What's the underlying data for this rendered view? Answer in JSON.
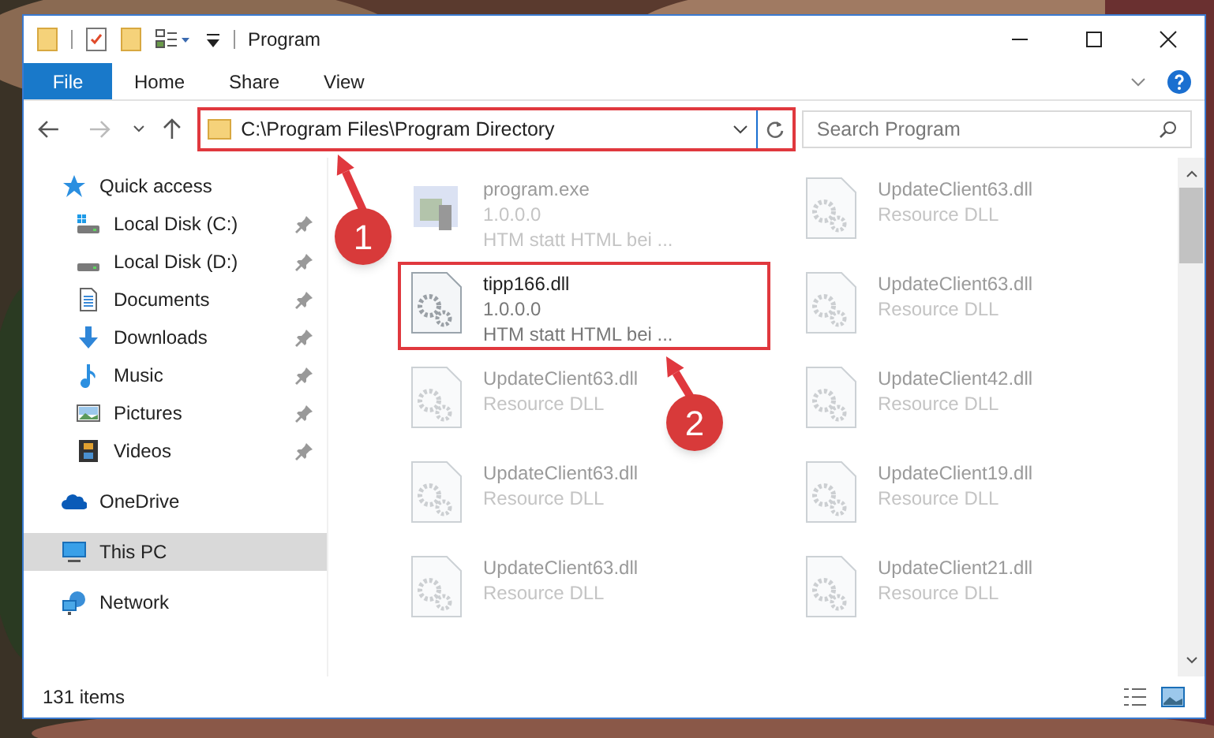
{
  "window": {
    "title": "Program"
  },
  "ribbon_tabs": [
    {
      "label": "File",
      "kind": "file"
    },
    {
      "label": "Home",
      "kind": "tab"
    },
    {
      "label": "Share",
      "kind": "tab"
    },
    {
      "label": "View",
      "kind": "tab"
    }
  ],
  "address_bar": {
    "path": "C:\\Program Files\\Program Directory",
    "highlighted": true
  },
  "search": {
    "placeholder": "Search Program"
  },
  "navigation": [
    {
      "label": "Quick access",
      "kind": "quickaccess",
      "selected": false,
      "children": [
        {
          "label": "Local Disk (C:)",
          "kind": "systemdrive",
          "pinned": true
        },
        {
          "label": "Local Disk (D:)",
          "kind": "drive",
          "pinned": true
        },
        {
          "label": "Documents",
          "kind": "documents",
          "pinned": true
        },
        {
          "label": "Downloads",
          "kind": "downloads",
          "pinned": true
        },
        {
          "label": "Music",
          "kind": "music",
          "pinned": true
        },
        {
          "label": "Pictures",
          "kind": "pictures",
          "pinned": true
        },
        {
          "label": "Videos",
          "kind": "videos",
          "pinned": true
        }
      ]
    },
    {
      "label": "OneDrive",
      "kind": "cloud",
      "selected": false
    },
    {
      "label": "This PC",
      "kind": "computer",
      "selected": true
    },
    {
      "label": "Network",
      "kind": "network",
      "selected": false
    }
  ],
  "files": [
    {
      "name": "program.exe",
      "lines": [
        "1.0.0.0",
        "HTM statt HTML bei ..."
      ],
      "kind": "exe",
      "blurred": true,
      "highlighted": false
    },
    {
      "name": "UpdateClient63.dll",
      "lines": [
        "Resource DLL"
      ],
      "kind": "dll",
      "blurred": true,
      "highlighted": false
    },
    {
      "name": "tipp166.dll",
      "lines": [
        "1.0.0.0",
        "HTM statt HTML bei ..."
      ],
      "kind": "dll",
      "blurred": false,
      "highlighted": true
    },
    {
      "name": "UpdateClient63.dll",
      "lines": [
        "Resource DLL"
      ],
      "kind": "dll",
      "blurred": true,
      "highlighted": false
    },
    {
      "name": "UpdateClient63.dll",
      "lines": [
        "Resource DLL"
      ],
      "kind": "dll",
      "blurred": true,
      "highlighted": false
    },
    {
      "name": "UpdateClient42.dll",
      "lines": [
        "Resource DLL"
      ],
      "kind": "dll",
      "blurred": true,
      "highlighted": false
    },
    {
      "name": "UpdateClient63.dll",
      "lines": [
        "Resource DLL"
      ],
      "kind": "dll",
      "blurred": true,
      "highlighted": false
    },
    {
      "name": "UpdateClient19.dll",
      "lines": [
        "Resource DLL"
      ],
      "kind": "dll",
      "blurred": true,
      "highlighted": false
    },
    {
      "name": "UpdateClient63.dll",
      "lines": [
        "Resource DLL"
      ],
      "kind": "dll",
      "blurred": true,
      "highlighted": false
    },
    {
      "name": "UpdateClient21.dll",
      "lines": [
        "Resource DLL"
      ],
      "kind": "dll",
      "blurred": true,
      "highlighted": false
    }
  ],
  "status_bar": {
    "item_count": "131 items"
  },
  "annotations": [
    {
      "number": "1"
    },
    {
      "number": "2"
    }
  ]
}
